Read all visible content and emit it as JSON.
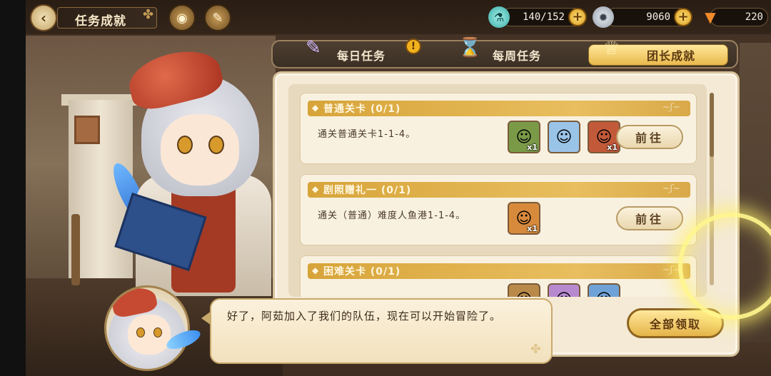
{
  "header": {
    "title": "任务成就",
    "back_icon": "chevron-left-icon",
    "icons": [
      "clover-icon",
      "eye-emblem-icon",
      "scroll-book-icon"
    ]
  },
  "resources": [
    {
      "name": "stamina",
      "icon": "potion-icon",
      "value": "140/152",
      "has_plus": true,
      "color": "#5ec9c4"
    },
    {
      "name": "coins",
      "icon": "gear-coin-icon",
      "value": "9060",
      "has_plus": true,
      "color": "#c0c7cf"
    },
    {
      "name": "carrots",
      "icon": "carrot-icon",
      "value": "220",
      "has_plus": false,
      "color": "#f08a2a"
    }
  ],
  "tabs": [
    {
      "label": "每日任务",
      "icon": "book-quill-icon",
      "active": false,
      "badge": "!"
    },
    {
      "label": "每周任务",
      "icon": "hourglass-icon",
      "active": false,
      "badge": ""
    },
    {
      "label": "团长成就",
      "icon": "trophy-icon",
      "active": true,
      "badge": ""
    }
  ],
  "tasks": [
    {
      "title": "普通关卡 (0/1)",
      "description": "通关普通关卡1-1-4。",
      "rewards": [
        {
          "icon": "character-card-icon",
          "qty": "x1",
          "color": "#7a9a48"
        },
        {
          "icon": "character-card-icon",
          "qty": "",
          "color": "#9ac3e8"
        },
        {
          "icon": "character-card-icon",
          "qty": "x1",
          "color": "#c25a3a"
        }
      ],
      "button": "前往"
    },
    {
      "title": "剧照赠礼一 (0/1)",
      "description": "通关（普通）难度人鱼港1-1-4。",
      "rewards": [
        {
          "icon": "character-card-icon",
          "qty": "x1",
          "color": "#d88a3c"
        }
      ],
      "button": "前往"
    },
    {
      "title": "困难关卡 (0/1)",
      "description": "",
      "rewards": [
        {
          "icon": "character-card-icon",
          "qty": "",
          "color": "#b98a4a"
        },
        {
          "icon": "character-card-icon",
          "qty": "",
          "color": "#b78ad0"
        },
        {
          "icon": "character-card-icon",
          "qty": "",
          "color": "#6fa2d6"
        }
      ],
      "button": ""
    }
  ],
  "claim_all": "全部领取",
  "dialog": {
    "text": "好了，阿茹加入了我们的队伍，现在可以开始冒险了。"
  },
  "colors": {
    "accent_gold": "#e5b449",
    "panel_bg": "#f4ead6",
    "highlight_glow": "#fff68c"
  }
}
